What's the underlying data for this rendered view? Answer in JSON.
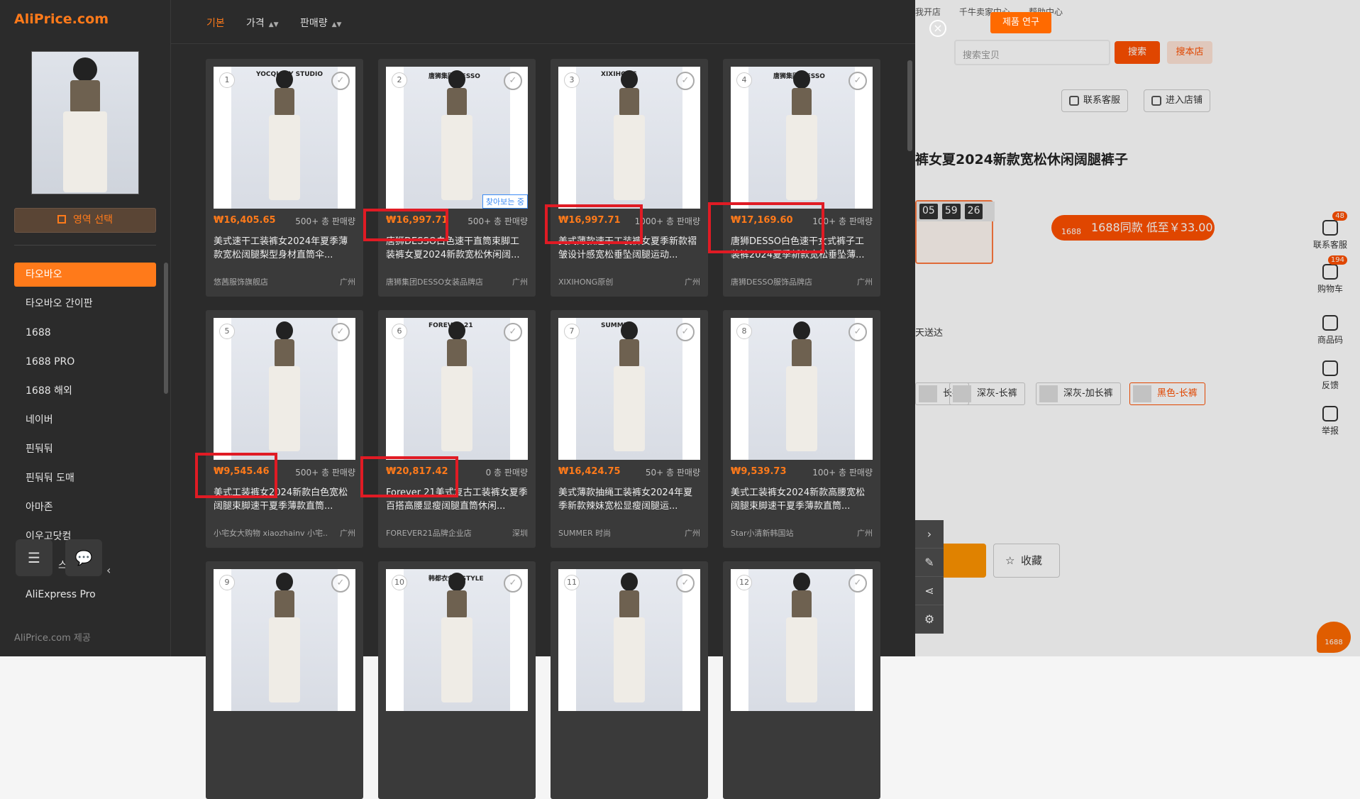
{
  "background_page": {
    "topnav": [
      "我开店",
      "千牛卖家中心",
      "帮助中心"
    ],
    "search_placeholder": "搜索宝贝",
    "search_btn": "搜索",
    "search_store_btn": "搜本店",
    "contact_service": "联系客服",
    "enter_store": "进入店铺",
    "product_title": "裤女夏2024新款宽松休闲阔腿裤子",
    "timer": [
      "05",
      "59",
      "26"
    ],
    "pill_logo": "1688",
    "pill_text": "1688同款 低至￥33.00",
    "deliver_text": "天送达",
    "skus": [
      "长裤",
      "深灰-长裤",
      "深灰-加长裤",
      "黑色-长裤"
    ],
    "favorite": "收藏",
    "right_bar": [
      {
        "label": "联系客服",
        "badge": "48"
      },
      {
        "label": "购物车",
        "badge": "194"
      },
      {
        "label": "商品码",
        "badge": ""
      },
      {
        "label": "反馈",
        "badge": ""
      },
      {
        "label": "举报",
        "badge": ""
      }
    ],
    "corner_logo": "1688"
  },
  "aliprice": {
    "brand": "AliPrice.com",
    "area_select": "영역 선택",
    "nav": [
      "타오바오",
      "타오바오 간이판",
      "1688",
      "1688 PRO",
      "1688 해외",
      "네이버",
      "핀둬둬",
      "핀둬둬 도매",
      "아마존",
      "이우고닷컴",
      "스",
      "AliExpress Pro"
    ],
    "footer": "AliPrice.com 제공",
    "tabs": {
      "basic": "기본",
      "price": "가격",
      "sales": "판매량"
    },
    "research_btn": "제품 연구",
    "products": [
      {
        "num": "1",
        "price": "₩16,405.65",
        "sales": "500+ 총 판매량",
        "title": "美式速干工装裤女2024年夏季薄款宽松阔腿梨型身材直筒伞...",
        "shop": "悠茜服饰旗舰店",
        "loc": "广州",
        "badge": "YOCQIANY STUDIO",
        "look": ""
      },
      {
        "num": "2",
        "price": "₩16,997.71",
        "sales": "500+ 총 판매량",
        "title": "唐狮DESSO白色速干直筒束脚工装裤女夏2024新款宽松休闲阔...",
        "shop": "唐狮集团DESSO女装品牌店",
        "loc": "广州",
        "badge": "唐狮集团 DESSO",
        "look": "찾아보는 중"
      },
      {
        "num": "3",
        "price": "₩16,997.71",
        "sales": "1000+ 총 판매량",
        "title": "美式薄款速干工装裤女夏季新款褶皱设计感宽松垂坠阔腿运动...",
        "shop": "XIXIHONG原创",
        "loc": "广州",
        "badge": "XIXIHONG",
        "look": ""
      },
      {
        "num": "4",
        "price": "₩17,169.60",
        "sales": "100+ 총 판매량",
        "title": "唐狮DESSO白色速干女式裤子工装裤2024夏季新款宽松垂坠薄...",
        "shop": "唐狮DESSO服饰品牌店",
        "loc": "广州",
        "badge": "唐狮集团 DESSO",
        "look": ""
      },
      {
        "num": "5",
        "price": "₩9,545.46",
        "sales": "500+ 총 판매량",
        "title": "美式工装裤女2024新款白色宽松阔腿束脚速干夏季薄款直筒...",
        "shop": "小宅女大购物 xiaozhainv 小宅...",
        "loc": "广州",
        "badge": "",
        "look": ""
      },
      {
        "num": "6",
        "price": "₩20,817.42",
        "sales": "0 총 판매량",
        "title": "Forever 21美式复古工装裤女夏季百搭高腰显瘦阔腿直筒休闲...",
        "shop": "FOREVER21品牌企业店",
        "loc": "深圳",
        "badge": "FOREVER 21",
        "look": ""
      },
      {
        "num": "7",
        "price": "₩16,424.75",
        "sales": "50+ 총 판매량",
        "title": "美式薄款抽绳工装裤女2024年夏季新款辣妹宽松显瘦阔腿运...",
        "shop": "SUMMER 时尚",
        "loc": "广州",
        "badge": "SUMMER",
        "look": ""
      },
      {
        "num": "8",
        "price": "₩9,539.73",
        "sales": "100+ 총 판매량",
        "title": "美式工装裤女2024新款高腰宽松阔腿束脚速干夏季薄款直筒...",
        "shop": "Star小清新韩国站",
        "loc": "广州",
        "badge": "",
        "look": ""
      },
      {
        "num": "9",
        "price": "",
        "sales": "",
        "title": "",
        "shop": "",
        "loc": "",
        "badge": "",
        "look": ""
      },
      {
        "num": "10",
        "price": "",
        "sales": "",
        "title": "",
        "shop": "",
        "loc": "",
        "badge": "韩都衣舍 HSTYLE",
        "look": ""
      },
      {
        "num": "11",
        "price": "",
        "sales": "",
        "title": "",
        "shop": "",
        "loc": "",
        "badge": "",
        "look": ""
      },
      {
        "num": "12",
        "price": "",
        "sales": "",
        "title": "",
        "shop": "",
        "loc": "",
        "badge": "",
        "look": ""
      }
    ]
  },
  "colors": {
    "accent": "#ff7a1a",
    "panel_bg": "#2b2b2b",
    "card_bg": "#3a3a3a",
    "highlight": "#e01b24"
  }
}
